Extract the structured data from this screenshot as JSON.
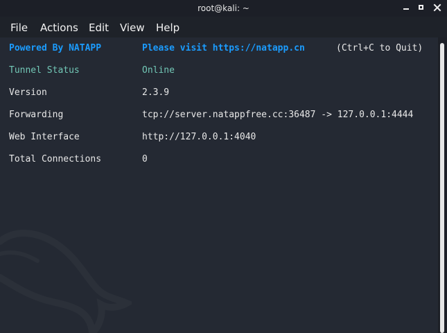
{
  "window": {
    "title": "root@kali: ~",
    "minimize_icon": "minimize-icon",
    "maximize_icon": "maximize-icon",
    "close_icon": "close-icon"
  },
  "menu": {
    "file": "File",
    "actions": "Actions",
    "edit": "Edit",
    "view": "View",
    "help": "Help"
  },
  "terminal": {
    "powered_label": "Powered By NATAPP",
    "visit_text": "Please visit https://natapp.cn",
    "quit_text": "(Ctrl+C to Quit)",
    "rows": [
      {
        "label": "Tunnel Status",
        "value": "Online"
      },
      {
        "label": "Version",
        "value": "2.3.9"
      },
      {
        "label": "Forwarding",
        "value": "tcp://server.natappfree.cc:36487 -> 127.0.0.1:4444"
      },
      {
        "label": "Web Interface",
        "value": "http://127.0.0.1:4040"
      },
      {
        "label": "Total Connections",
        "value": "0"
      }
    ]
  },
  "colors": {
    "blue": "#1b9cff",
    "green": "#72c7b6",
    "background": "#242933"
  }
}
